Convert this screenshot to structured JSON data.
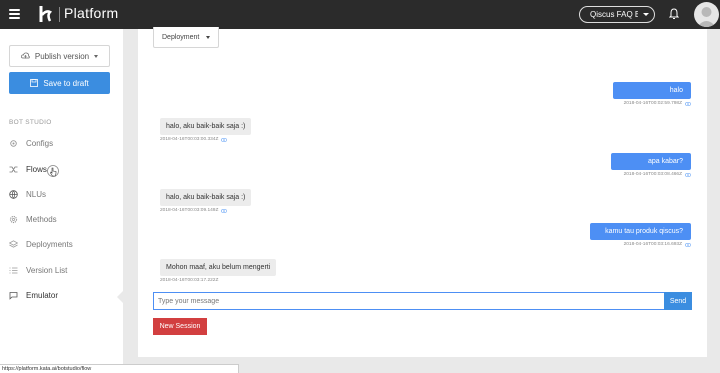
{
  "app": {
    "brand": "Platform",
    "bot_name": "Qiscus FAQ Bot"
  },
  "sidebar": {
    "publish_label": "Publish version",
    "save_label": "Save to draft",
    "section_title": "BOT STUDIO",
    "items": [
      {
        "label": "Configs",
        "icon": "gear-icon"
      },
      {
        "label": "Flows",
        "icon": "shuffle-icon"
      },
      {
        "label": "NLUs",
        "icon": "globe-icon"
      },
      {
        "label": "Methods",
        "icon": "settings-icon"
      },
      {
        "label": "Deployments",
        "icon": "layers-icon"
      },
      {
        "label": "Version List",
        "icon": "list-icon"
      },
      {
        "label": "Emulator",
        "icon": "chat-icon"
      }
    ]
  },
  "emulator": {
    "deployment_label": "Deployment",
    "messages": [
      {
        "from": "user",
        "text": "halo",
        "time": "2018-04-16T00:02:59.798Z"
      },
      {
        "from": "bot",
        "text": "halo, aku baik-baik saja :)",
        "time": "2018-04-16T00:03:00.334Z"
      },
      {
        "from": "user",
        "text": "apa kabar?",
        "time": "2018-04-16T00:03:08.466Z"
      },
      {
        "from": "bot",
        "text": "halo, aku baik-baik saja :)",
        "time": "2018-04-16T00:03:09.149Z"
      },
      {
        "from": "user",
        "text": "kamu tau produk qiscus?",
        "time": "2018-04-16T00:03:16.693Z"
      },
      {
        "from": "bot",
        "text": "Mohon maaf, aku belum mengerti",
        "time": "2018-04-16T00:03:17.222Z"
      }
    ],
    "input_placeholder": "Type your message",
    "send_label": "Send",
    "new_session_label": "New Session"
  },
  "status_url": "https://platform.kata.ai/botstudio/flow",
  "colors": {
    "accent": "#3b8de0",
    "user_bubble": "#4d8ff4",
    "danger": "#d23f40",
    "topbar": "#2b2b2b"
  }
}
